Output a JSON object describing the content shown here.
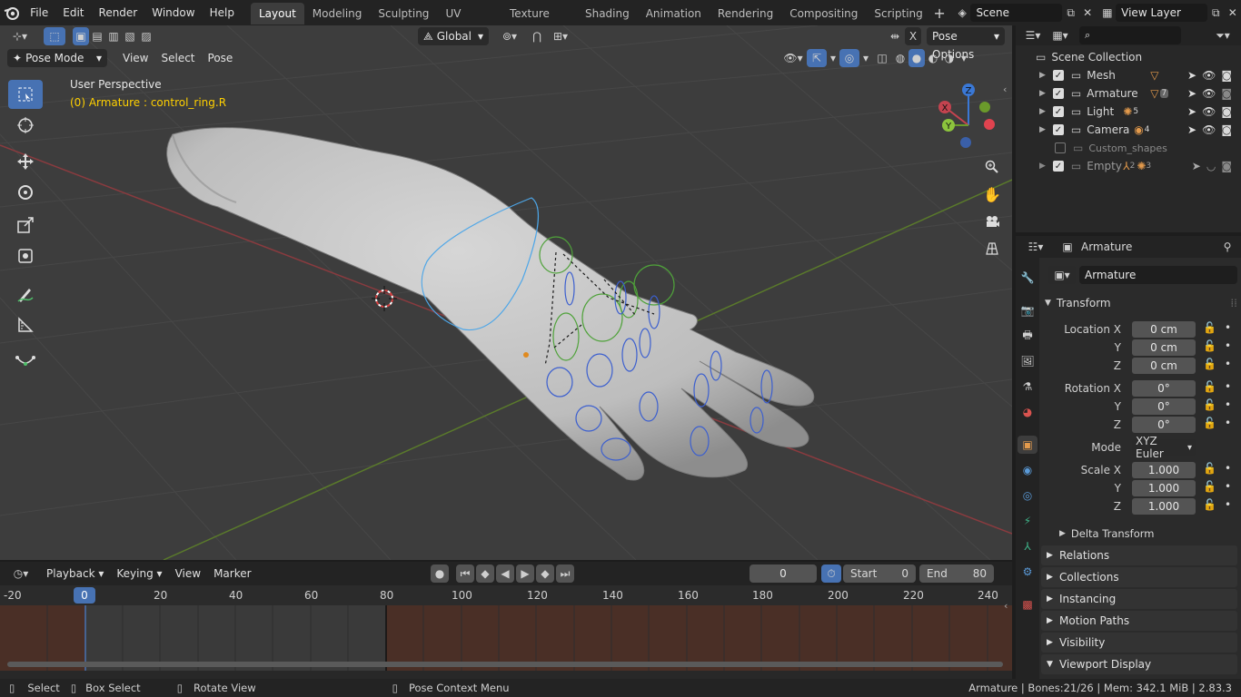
{
  "topbar": {
    "menus": [
      "File",
      "Edit",
      "Render",
      "Window",
      "Help"
    ],
    "workspaces": [
      "Layout",
      "Modeling",
      "Sculpting",
      "UV Editing",
      "Texture Paint",
      "Shading",
      "Animation",
      "Rendering",
      "Compositing",
      "Scripting"
    ],
    "active_workspace": "Layout",
    "scene": "Scene",
    "view_layer": "View Layer"
  },
  "viewport": {
    "transform_orientation": "Global",
    "pose_options": "Pose Options",
    "mode": "Pose Mode",
    "menus": [
      "View",
      "Select",
      "Pose"
    ],
    "perspective": "User Perspective",
    "active_info": "(0) Armature : control_ring.R",
    "axis_labels": {
      "x": "X",
      "y": "Y",
      "z": "Z"
    },
    "x_shortcut": "X"
  },
  "timeline": {
    "menus": [
      "Playback",
      "Keying",
      "View",
      "Marker"
    ],
    "current_frame": "0",
    "start_label": "Start",
    "start": "0",
    "end_label": "End",
    "end": "80",
    "ruler": [
      "-20",
      "0",
      "20",
      "40",
      "60",
      "80",
      "100",
      "120",
      "140",
      "160",
      "180",
      "200",
      "220",
      "240"
    ]
  },
  "outliner": {
    "search_placeholder": "",
    "root": "Scene Collection",
    "items": [
      {
        "name": "Mesh",
        "badge": ""
      },
      {
        "name": "Armature",
        "badge": "7"
      },
      {
        "name": "Light",
        "badge": "5"
      },
      {
        "name": "Camera",
        "badge": "4"
      },
      {
        "name": "Custom_shapes",
        "badge": ""
      },
      {
        "name": "Empty",
        "badge": "2",
        "badge2": "3"
      }
    ]
  },
  "properties": {
    "object_name": "Armature",
    "data_name": "Armature",
    "transform_title": "Transform",
    "location_label": "Location X",
    "location": [
      "0 cm",
      "0 cm",
      "0 cm"
    ],
    "rotation_label": "Rotation X",
    "rotation": [
      "0°",
      "0°",
      "0°"
    ],
    "mode_label": "Mode",
    "mode": "XYZ Euler",
    "scale_label": "Scale X",
    "scale": [
      "1.000",
      "1.000",
      "1.000"
    ],
    "y_label": "Y",
    "z_label": "Z",
    "panels": [
      "Delta Transform",
      "Relations",
      "Collections",
      "Instancing",
      "Motion Paths",
      "Visibility",
      "Viewport Display"
    ]
  },
  "statusbar": {
    "select": "Select",
    "box_select": "Box Select",
    "rotate_view": "Rotate View",
    "context_menu": "Pose Context Menu",
    "stats": "Armature | Bones:21/26 | Mem: 342.1 MiB | 2.83.3"
  },
  "colors": {
    "accent": "#4772b3",
    "active_text": "#ffd000",
    "x_axis": "#c4434f",
    "y_axis": "#6b9a2b",
    "z_axis": "#3a78d6"
  }
}
